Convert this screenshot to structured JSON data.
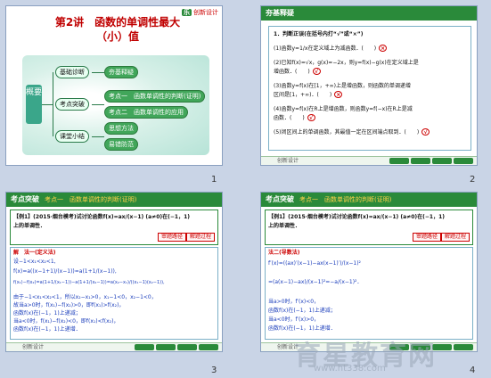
{
  "watermark": {
    "title": "育星教育网",
    "url": "www.ht338.com"
  },
  "logo": {
    "badge": "乐",
    "text": "创新设计"
  },
  "slide_numbers": [
    "1",
    "2",
    "3",
    "4"
  ],
  "slide1": {
    "title_line1": "第2讲　函数的单调性最大",
    "title_line2": "（小）值",
    "side_label": "概要",
    "left_items": [
      "基础诊断",
      "考点突破",
      "课堂小结"
    ],
    "right_items": [
      "夯基释疑",
      "考点一　函数单调性的判断(证明)",
      "考点二　函数单调性的应用",
      "思想方法",
      "易错防范"
    ]
  },
  "slide2": {
    "header": "夯基释疑",
    "lines": [
      "1．判断正误(在括号内打“√”或“×”)",
      "(1)函数y=1/x在定义域上为减函数．(　　)",
      "(2)已知f(x)=√x，g(x)=−2x，则y=f(x)−g(x)在定义域上是",
      "增函数．(　　)",
      "(3)函数y=f(x)在[1，+∞)上是增函数，则函数的单调递增",
      "区间是[1，+∞)．(　　)",
      "(4)函数y=f(x)在R上是增函数，则函数y=f(−x)在R上是减",
      "函数．(　　)",
      "(5)闭区间上的单调函数，其最值一定在区间端点取到．(　　)"
    ],
    "marks": [
      "×",
      "√",
      "×",
      "√",
      "√"
    ]
  },
  "slide3": {
    "header": "考点突破",
    "header_sub": "考点一　函数单调性的判断(证明)",
    "problem_line1": "【例1】(2015·烟台模考)试讨论函数f(x)=ax/(x−1) (a≠0)在(−1，1)",
    "problem_line2": "上的单调性．",
    "badge1": "审题路径",
    "badge2": "解题过程",
    "method": "解　法一(定义法)",
    "lines": [
      "设−1<x₁<x₂<1,",
      "f(x)=a((x−1+1)/(x−1))=a(1+1/(x−1)),",
      "f(x₁)−f(x₂)=a(1+1/(x₁−1))−a(1+1/(x₂−1))=a(x₂−x₁)/((x₁−1)(x₂−1)),",
      "由于−1<x₁<x₂<1，所以x₂−x₁>0，x₁−1<0，x₂−1<0，",
      "故当a>0时，f(x₁)−f(x₂)>0，即f(x₁)>f(x₂)，",
      "函数f(x)在(−1，1)上递减；",
      "当a<0时，f(x₁)−f(x₂)<0，即f(x₁)<f(x₂)，",
      "函数f(x)在(−1，1)上递增．"
    ]
  },
  "slide4": {
    "header": "考点突破",
    "header_sub": "考点一　函数单调性的判断(证明)",
    "problem_line1": "【例1】(2015·烟台模考)试讨论函数f(x)=ax/(x−1) (a≠0)在(−1，1)",
    "problem_line2": "上的单调性．",
    "badge1": "审题路径",
    "badge2": "解题过程",
    "method": "法二(导数法)",
    "lines": [
      "f′(x)=((ax)′(x−1)−ax(x−1)′)/(x−1)²",
      "=(a(x−1)−ax)/(x−1)²=−a/(x−1)²．",
      "当a>0时，f′(x)<0，",
      "函数f(x)在(−1，1)上递减；",
      "当a<0时，f′(x)>0，",
      "函数f(x)在(−1，1)上递增．"
    ]
  },
  "footer": {
    "text": "创新设计",
    "buttons": [
      "上一页",
      "返回",
      "下一页",
      "结束"
    ]
  }
}
